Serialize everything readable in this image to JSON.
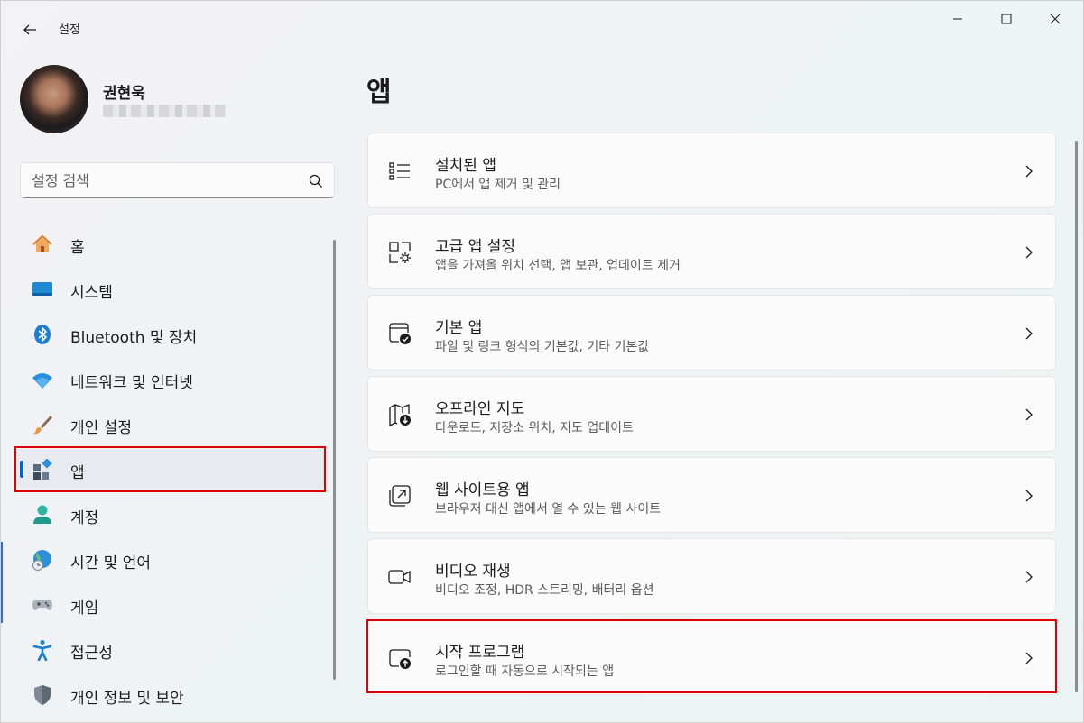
{
  "window": {
    "title": "설정"
  },
  "profile": {
    "name": "권현욱"
  },
  "search": {
    "placeholder": "설정 검색"
  },
  "nav": {
    "items": [
      {
        "label": "홈",
        "icon": "home-icon"
      },
      {
        "label": "시스템",
        "icon": "system-icon"
      },
      {
        "label": "Bluetooth 및 장치",
        "icon": "bluetooth-icon"
      },
      {
        "label": "네트워크 및 인터넷",
        "icon": "wifi-icon"
      },
      {
        "label": "개인 설정",
        "icon": "brush-icon"
      },
      {
        "label": "앱",
        "icon": "apps-icon",
        "selected": true
      },
      {
        "label": "계정",
        "icon": "account-icon"
      },
      {
        "label": "시간 및 언어",
        "icon": "globe-clock-icon"
      },
      {
        "label": "게임",
        "icon": "gamepad-icon"
      },
      {
        "label": "접근성",
        "icon": "accessibility-icon"
      },
      {
        "label": "개인 정보 및 보안",
        "icon": "shield-icon"
      }
    ]
  },
  "main": {
    "title": "앱",
    "cards": [
      {
        "title": "설치된 앱",
        "subtitle": "PC에서 앱 제거 및 관리",
        "icon": "list-icon"
      },
      {
        "title": "고급 앱 설정",
        "subtitle": "앱을 가져올 위치 선택, 앱 보관, 업데이트 제거",
        "icon": "app-settings-icon"
      },
      {
        "title": "기본 앱",
        "subtitle": "파일 및 링크 형식의 기본값, 기타 기본값",
        "icon": "default-apps-icon"
      },
      {
        "title": "오프라인 지도",
        "subtitle": "다운로드, 저장소 위치, 지도 업데이트",
        "icon": "map-download-icon"
      },
      {
        "title": "웹 사이트용 앱",
        "subtitle": "브라우저 대신 앱에서 열 수 있는 웹 사이트",
        "icon": "open-external-icon"
      },
      {
        "title": "비디오 재생",
        "subtitle": "비디오 조정, HDR 스트리밍, 배터리 옵션",
        "icon": "video-icon"
      },
      {
        "title": "시작 프로그램",
        "subtitle": "로그인할 때 자동으로 시작되는 앱",
        "icon": "startup-icon"
      }
    ]
  }
}
